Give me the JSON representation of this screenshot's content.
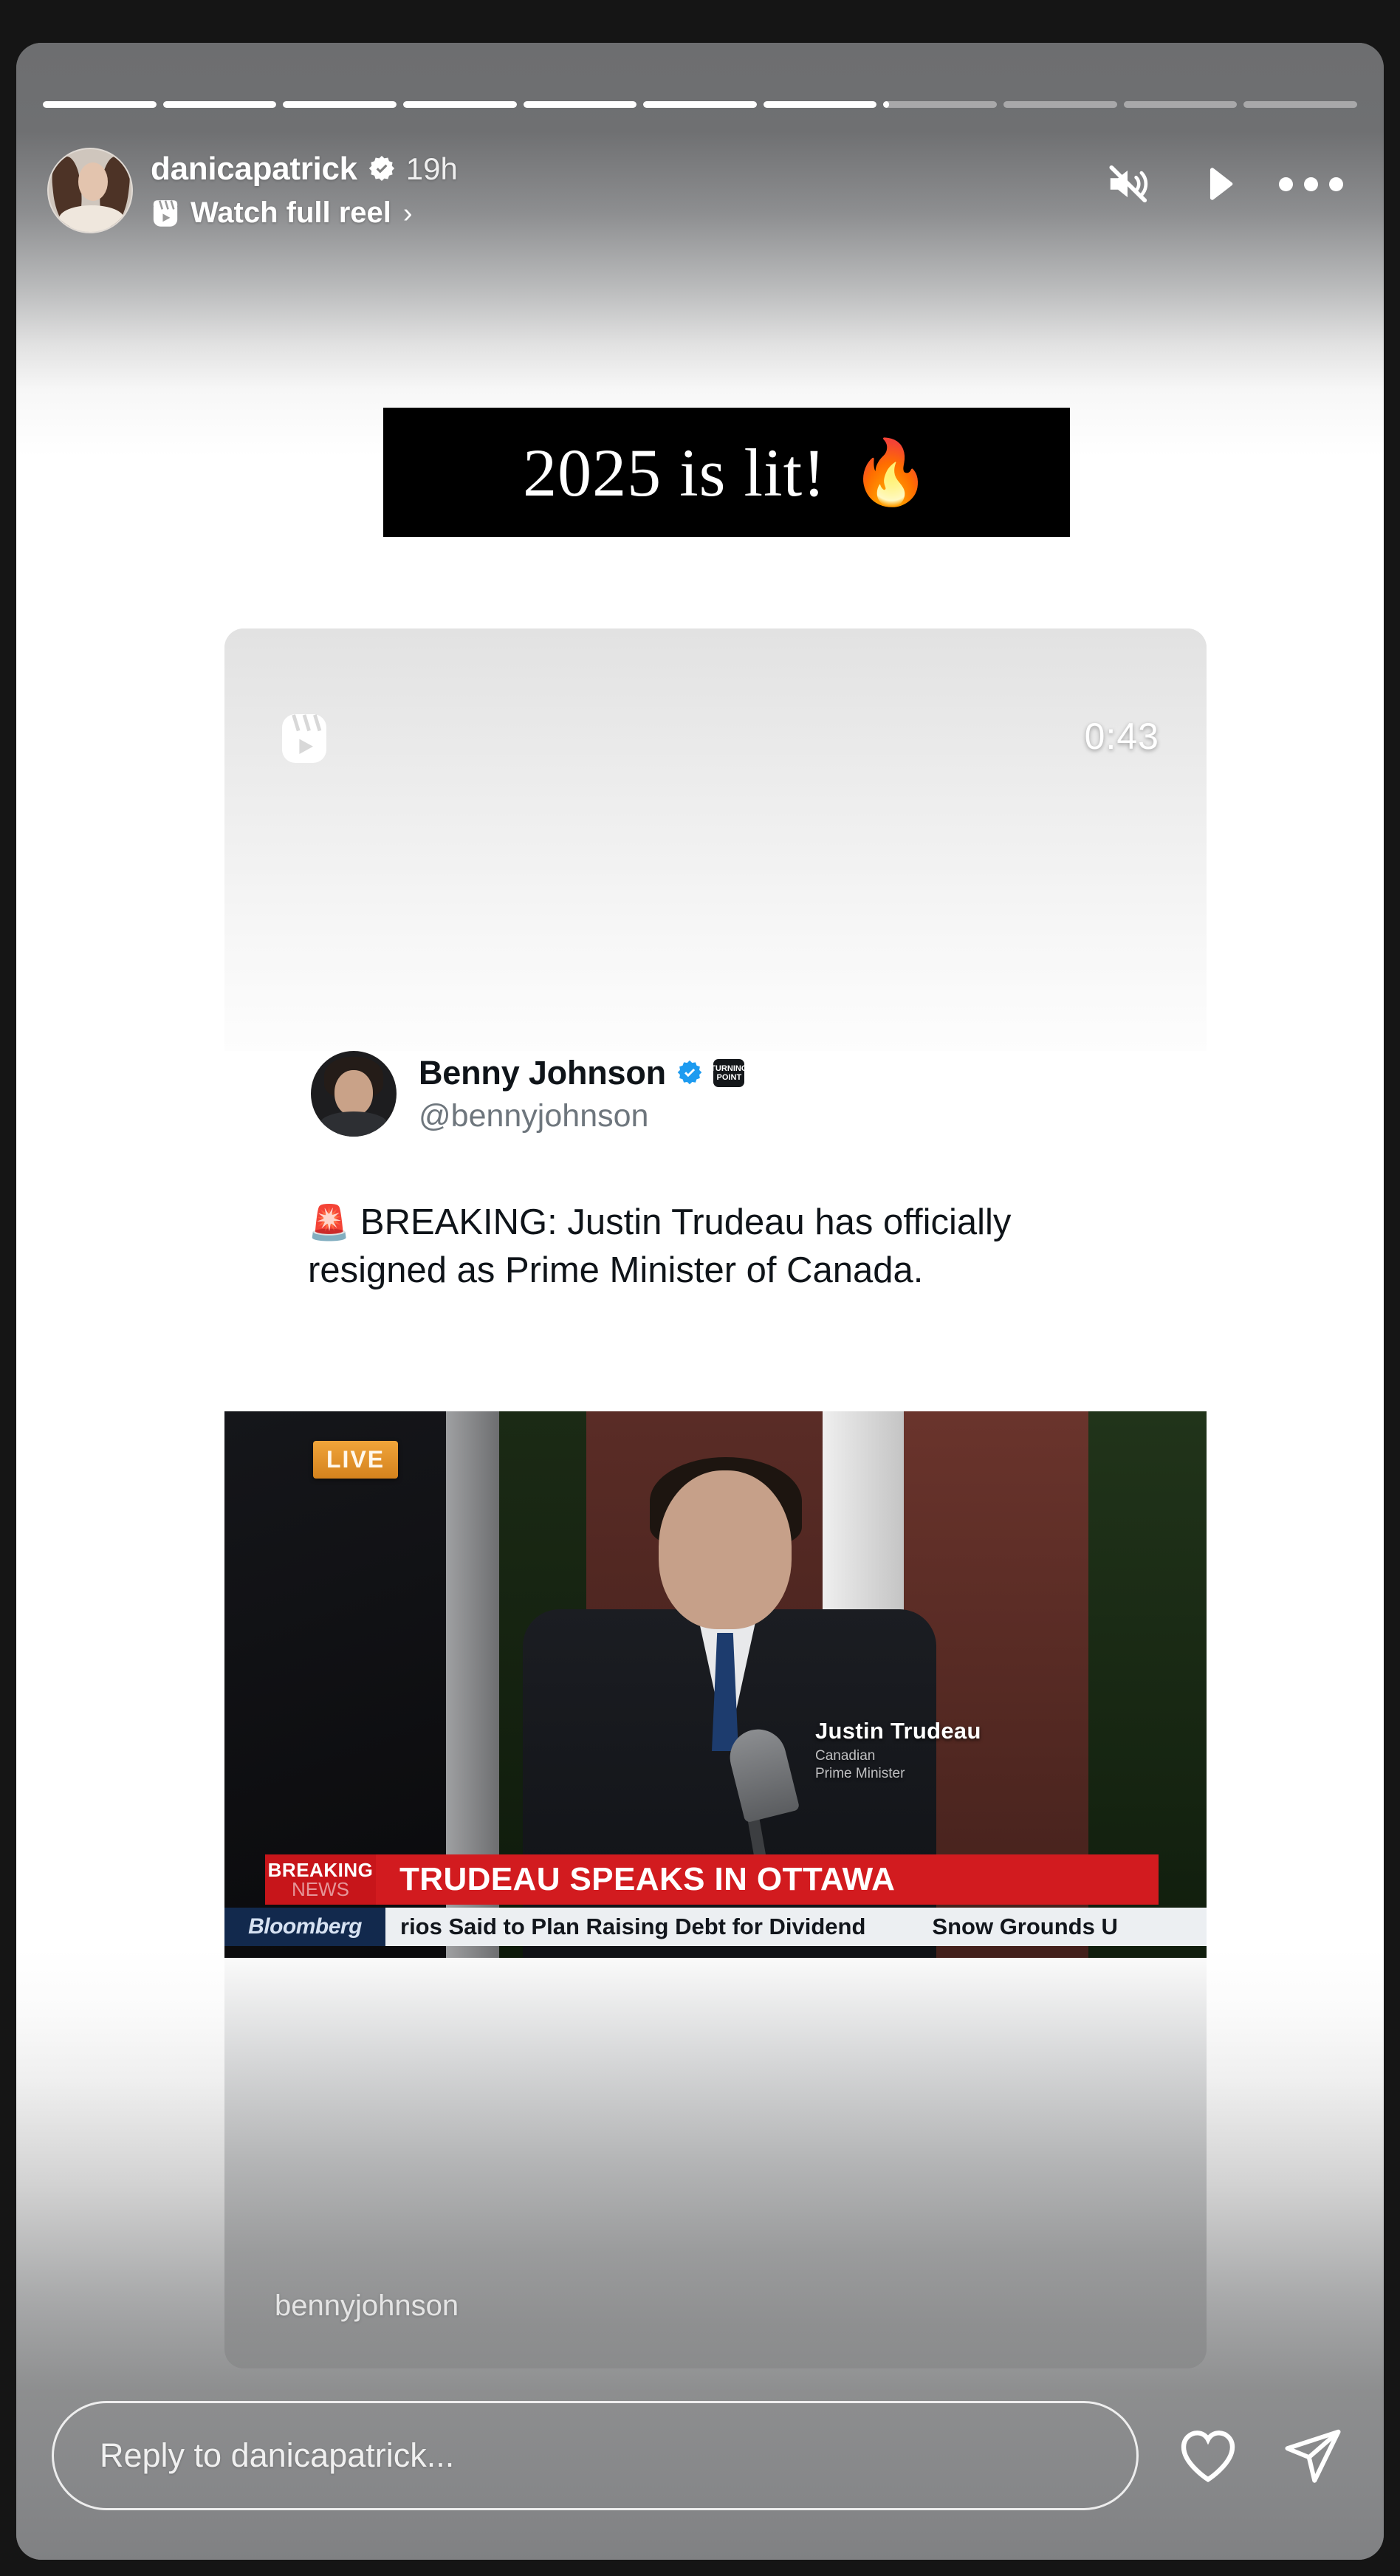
{
  "app": "instagram-story-viewer",
  "story": {
    "progress": {
      "total_segments": 11,
      "completed": 7,
      "current_index": 7,
      "current_fill_percent": 5
    },
    "header": {
      "username": "danicapatrick",
      "verified": true,
      "verified_icon": "verified-badge-icon",
      "timestamp": "19h",
      "reel_cta_label": "Watch full reel",
      "reel_cta_icon": "reel-clapper-icon",
      "reel_cta_chevron": "›",
      "actions": [
        {
          "name": "mute",
          "icon": "speaker-muted-icon",
          "state": "muted"
        },
        {
          "name": "play",
          "icon": "play-icon",
          "state": "paused"
        },
        {
          "name": "more-options",
          "icon": "ellipsis-icon"
        }
      ]
    },
    "sticker": {
      "text": "2025 is lit!",
      "emoji": "🔥",
      "background": "#000000",
      "text_color": "#ffffff"
    },
    "post_card": {
      "reel_preview": {
        "icon": "reel-clapper-icon",
        "duration": "0:43"
      },
      "tweet": {
        "display_name": "Benny Johnson",
        "verified": true,
        "verified_icon": "twitter-verified-icon",
        "affiliation_icon": "affiliation-badge-icon",
        "affiliation_label": "TURNING POINT",
        "handle": "@bennyjohnson",
        "emoji": "🚨",
        "text": "BREAKING: Justin Trudeau has officially resigned as Prime Minister of Canada."
      },
      "news_image": {
        "live_badge": "LIVE",
        "nameplate_name": "Justin Trudeau",
        "nameplate_title": "Canadian\nPrime Minister",
        "chyron_breaking_line1": "BREAKING",
        "chyron_breaking_line2": "NEWS",
        "chyron_headline": "TRUDEAU SPEAKS IN OTTAWA",
        "ticker_brand": "Bloomberg",
        "ticker_items": [
          "rios Said to Plan Raising Debt for Dividend",
          "Snow Grounds U"
        ],
        "colors": {
          "live": "#e09233",
          "breaking_red": "#c7151a",
          "ticker_blue": "#12294d"
        }
      },
      "attribution": "bennyjohnson"
    },
    "reply": {
      "placeholder": "Reply to danicapatrick...",
      "like_icon": "heart-icon",
      "send_icon": "paper-plane-icon"
    }
  }
}
